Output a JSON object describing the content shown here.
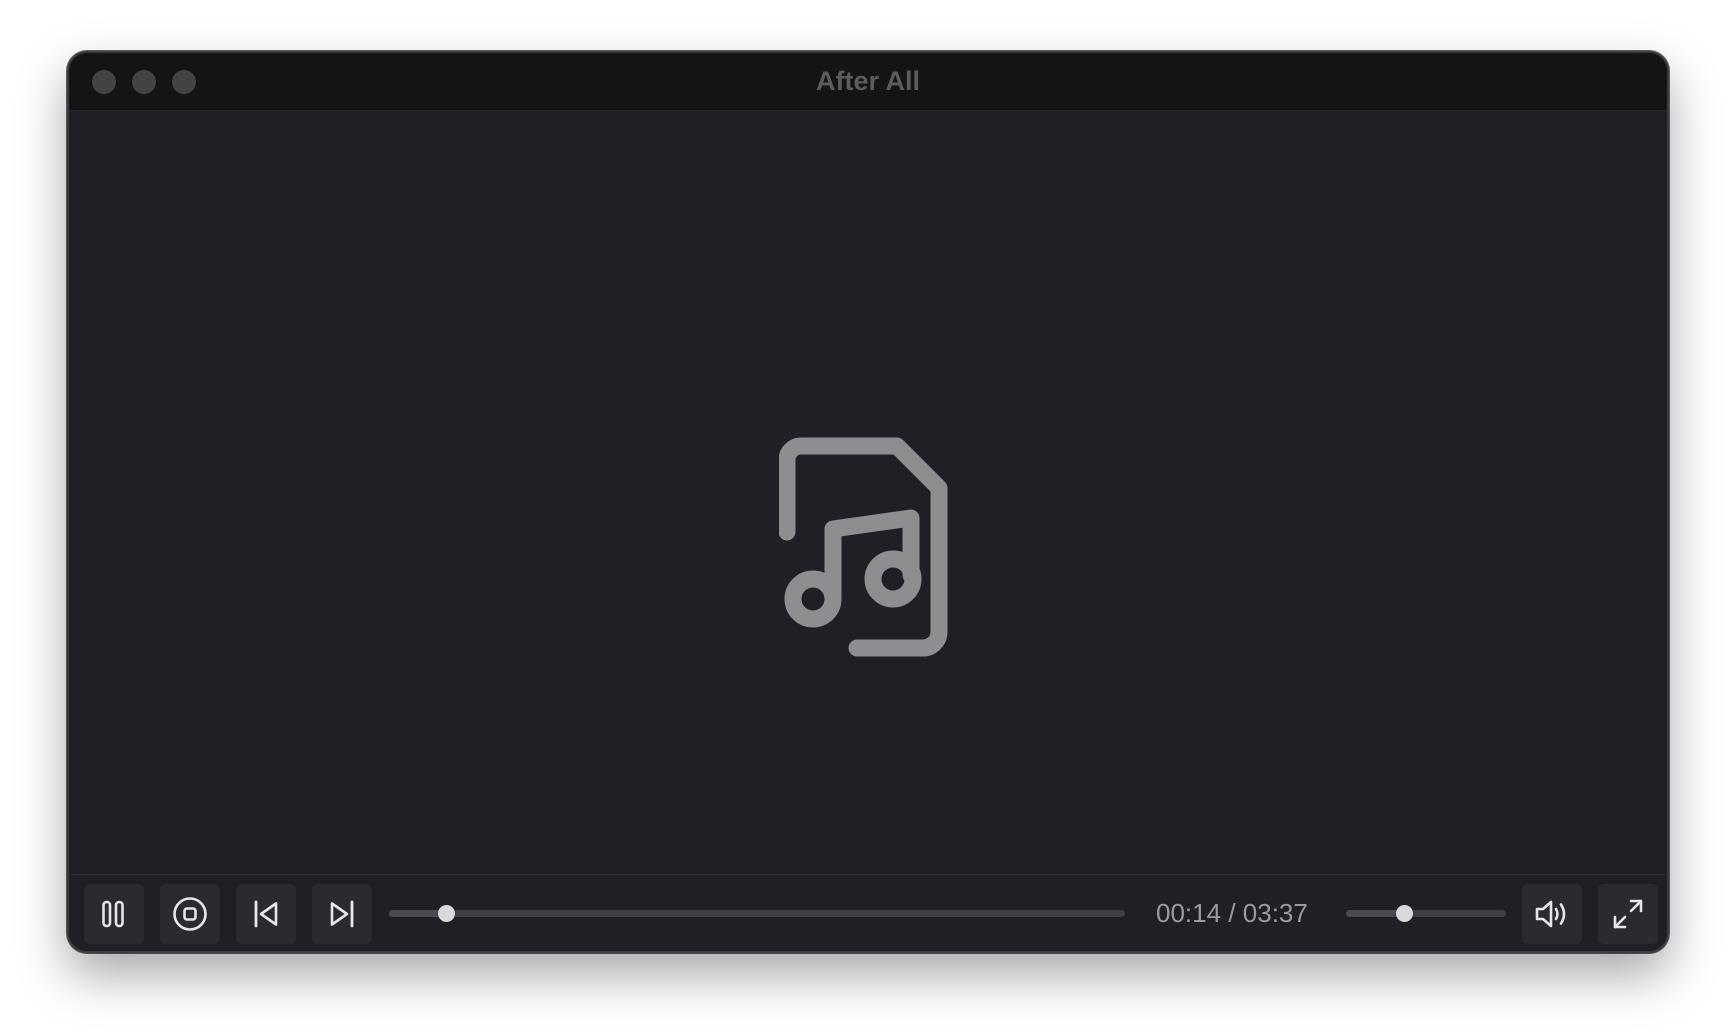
{
  "window": {
    "title": "After All"
  },
  "media": {
    "placeholder_icon": "music-file-icon",
    "icon_color": "#8e8e91"
  },
  "controls": {
    "buttons": [
      {
        "name": "pause",
        "icon": "pause-icon"
      },
      {
        "name": "stop",
        "icon": "stop-icon"
      },
      {
        "name": "previous",
        "icon": "skip-back-icon"
      },
      {
        "name": "next",
        "icon": "skip-forward-icon"
      },
      {
        "name": "volume",
        "icon": "volume-icon"
      },
      {
        "name": "fullscreen",
        "icon": "expand-icon"
      }
    ],
    "elapsed": "00:14",
    "separator": "/",
    "duration": "03:37",
    "progress_fraction": 0.077,
    "volume_fraction": 0.36
  },
  "colors": {
    "window_bg": "#1f2025",
    "titlebar_bg": "#141414",
    "button_bg": "#2a2b30",
    "icon": "#e6e6e8",
    "thumb": "#d9d9dc",
    "time_text": "#9a9ba0"
  }
}
